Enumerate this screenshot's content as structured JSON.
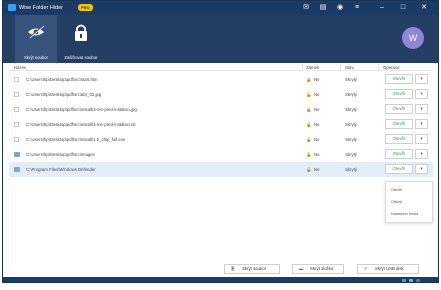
{
  "window": {
    "title": "Wise Folder Hider",
    "badge": "PRO",
    "controls": [
      "mail-icon",
      "menu-icon",
      "skin-icon",
      "list-icon",
      "minimize-icon",
      "maximize-icon",
      "close-icon"
    ]
  },
  "toolbar": {
    "tabs": [
      {
        "label": "Skrýt soubor",
        "icon": "eye-hidden-icon",
        "active": true
      },
      {
        "label": "Zašifrovat soubor",
        "icon": "lock-icon",
        "active": false
      }
    ],
    "avatar_letter": "W"
  },
  "table": {
    "headers": {
      "name": "Název",
      "lock": "Zámek",
      "state": "Stav",
      "operation": "Operace"
    },
    "rows": [
      {
        "path": "C:\\Users\\hp\\Desktop\\pdf\\src\\start.htm",
        "lock": "Ne",
        "state": "Skrytý",
        "op": "Otevřít",
        "type": "file",
        "selected": false
      },
      {
        "path": "C:\\Users\\hp\\Desktop\\pdf\\src\\abr_02.jpg",
        "lock": "Ne",
        "state": "Skrytý",
        "op": "Otevřít",
        "type": "file",
        "selected": false
      },
      {
        "path": "C:\\Users\\hp\\Desktop\\pdf\\src\\install\\3-me-pred-instalaci.jpg",
        "lock": "Ne",
        "state": "Skrytý",
        "op": "Otevřít",
        "type": "file",
        "selected": false
      },
      {
        "path": "C:\\Users\\hp\\Desktop\\pdf\\src\\install\\3-me-pred-instalaci.txt",
        "lock": "Ne",
        "state": "Skrytý",
        "op": "Otevřít",
        "type": "file",
        "selected": false
      },
      {
        "path": "C:\\Users\\hp\\Desktop\\pdf\\src\\install\\1.5_chip_full.exe",
        "lock": "Ne",
        "state": "Skrytý",
        "op": "Otevřít",
        "type": "file",
        "selected": false
      },
      {
        "path": "C:\\Users\\hp\\Desktop\\pdf\\src\\images",
        "lock": "Ne",
        "state": "Skrytý",
        "op": "Otevřít",
        "type": "folder",
        "selected": false
      },
      {
        "path": "C:\\Program Files\\Windows Defender",
        "lock": "Ne",
        "state": "Skrytý",
        "op": "Otevřít",
        "type": "folder",
        "selected": true
      }
    ]
  },
  "dropdown_menu": {
    "items": [
      "Otevřít",
      "Odkrýt",
      "Nastavení hesla"
    ]
  },
  "buttons": {
    "hide_file": "Skrýt soubor",
    "hide_folder": "Skrýt složku",
    "hide_usb": "Skrýt USB disk"
  },
  "colors": {
    "titlebar": "#1c3a66",
    "toolbar": "#243e64",
    "accent_green": "#3ba24a",
    "selected_row": "#e3edf8"
  }
}
